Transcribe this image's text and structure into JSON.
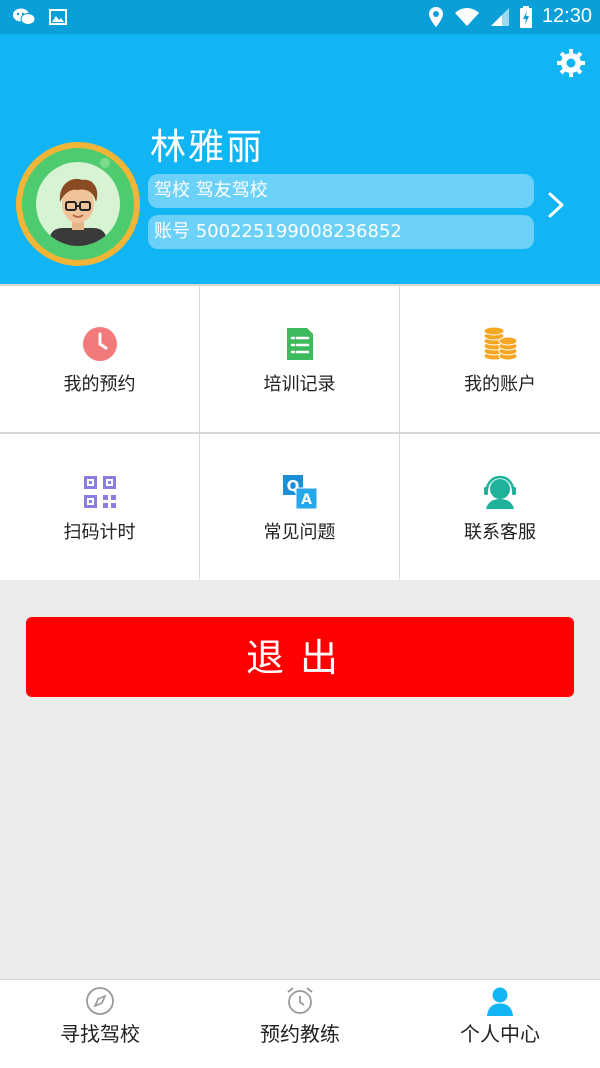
{
  "statusbar": {
    "time": "12:30"
  },
  "profile": {
    "name": "林雅丽",
    "school": "驾校 驾友驾校",
    "account": "账号 500225199008236852"
  },
  "menu": [
    {
      "label": "我的预约",
      "icon": "clock-icon"
    },
    {
      "label": "培训记录",
      "icon": "list-icon"
    },
    {
      "label": "我的账户",
      "icon": "coins-icon"
    },
    {
      "label": "扫码计时",
      "icon": "qr-code-icon"
    },
    {
      "label": "常见问题",
      "icon": "qa-icon"
    },
    {
      "label": "联系客服",
      "icon": "support-agent-icon"
    }
  ],
  "logout_label": "退出",
  "bottom_nav": [
    {
      "label": "寻找驾校",
      "icon": "compass-icon"
    },
    {
      "label": "预约教练",
      "icon": "alarm-clock-icon"
    },
    {
      "label": "个人中心",
      "icon": "person-icon"
    }
  ],
  "colors": {
    "primary": "#12b5f4",
    "logout": "#ff0000",
    "active_nav": "#12b5f4"
  }
}
